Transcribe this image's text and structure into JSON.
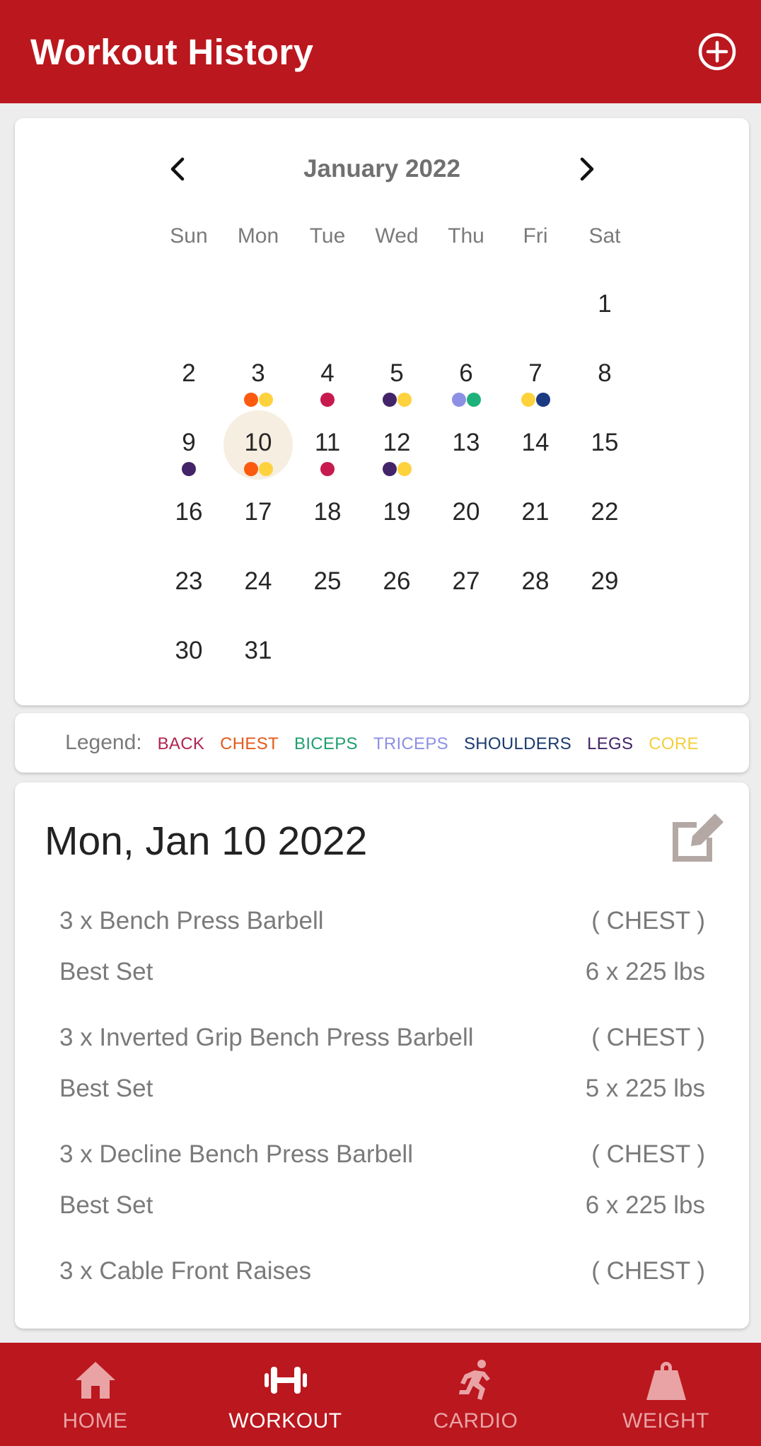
{
  "appbar": {
    "title": "Workout History",
    "add_icon": "add-circle-icon"
  },
  "calendar": {
    "month_label": "January 2022",
    "weekdays": [
      "Sun",
      "Mon",
      "Tue",
      "Wed",
      "Thu",
      "Fri",
      "Sat"
    ],
    "first_weekday_index": 6,
    "selected_day": 10,
    "selected_color": "#f6eee1",
    "days": [
      {
        "n": "1",
        "dots": []
      },
      {
        "n": "2",
        "dots": []
      },
      {
        "n": "3",
        "dots": [
          "#fb5a0f",
          "#fdd23d"
        ]
      },
      {
        "n": "4",
        "dots": [
          "#c71a4e"
        ]
      },
      {
        "n": "5",
        "dots": [
          "#432468",
          "#fdd23d"
        ]
      },
      {
        "n": "6",
        "dots": [
          "#8c90e4",
          "#1eb27a"
        ]
      },
      {
        "n": "7",
        "dots": [
          "#fdd23d",
          "#1a3a82"
        ]
      },
      {
        "n": "8",
        "dots": []
      },
      {
        "n": "9",
        "dots": [
          "#432468"
        ]
      },
      {
        "n": "10",
        "dots": [
          "#fb5a0f",
          "#fdd23d"
        ]
      },
      {
        "n": "11",
        "dots": [
          "#c71a4e"
        ]
      },
      {
        "n": "12",
        "dots": [
          "#432468",
          "#fdd23d"
        ]
      },
      {
        "n": "13",
        "dots": []
      },
      {
        "n": "14",
        "dots": []
      },
      {
        "n": "15",
        "dots": []
      },
      {
        "n": "16",
        "dots": []
      },
      {
        "n": "17",
        "dots": []
      },
      {
        "n": "18",
        "dots": []
      },
      {
        "n": "19",
        "dots": []
      },
      {
        "n": "20",
        "dots": []
      },
      {
        "n": "21",
        "dots": []
      },
      {
        "n": "22",
        "dots": []
      },
      {
        "n": "23",
        "dots": []
      },
      {
        "n": "24",
        "dots": []
      },
      {
        "n": "25",
        "dots": []
      },
      {
        "n": "26",
        "dots": []
      },
      {
        "n": "27",
        "dots": []
      },
      {
        "n": "28",
        "dots": []
      },
      {
        "n": "29",
        "dots": []
      },
      {
        "n": "30",
        "dots": []
      },
      {
        "n": "31",
        "dots": []
      }
    ]
  },
  "legend": {
    "label": "Legend:",
    "items": [
      {
        "name": "BACK",
        "color": "#b0244f"
      },
      {
        "name": "CHEST",
        "color": "#e35a1c"
      },
      {
        "name": "BICEPS",
        "color": "#1f9e6f"
      },
      {
        "name": "TRICEPS",
        "color": "#8c90e4"
      },
      {
        "name": "SHOULDERS",
        "color": "#1a3a6e"
      },
      {
        "name": "LEGS",
        "color": "#432468"
      },
      {
        "name": "CORE",
        "color": "#f3cf3d"
      }
    ]
  },
  "detail": {
    "date": "Mon, Jan 10 2022",
    "edit_icon": "edit-icon",
    "exercises": [
      {
        "name": "3 x Bench Press Barbell",
        "group": "( CHEST )",
        "best_label": "Best Set",
        "best_value": "6 x 225 lbs"
      },
      {
        "name": "3 x Inverted Grip Bench Press Barbell",
        "group": "( CHEST )",
        "best_label": "Best Set",
        "best_value": "5 x 225 lbs"
      },
      {
        "name": "3 x Decline Bench Press Barbell",
        "group": "( CHEST )",
        "best_label": "Best Set",
        "best_value": "6 x 225 lbs"
      },
      {
        "name": "3 x Cable Front Raises",
        "group": "( CHEST )",
        "best_label": "",
        "best_value": ""
      }
    ]
  },
  "nav": {
    "items": [
      {
        "label": "HOME",
        "icon": "home-icon",
        "active": false
      },
      {
        "label": "WORKOUT",
        "icon": "dumbbell-icon",
        "active": true
      },
      {
        "label": "CARDIO",
        "icon": "running-icon",
        "active": false
      },
      {
        "label": "WEIGHT",
        "icon": "weight-icon",
        "active": false
      }
    ]
  },
  "colors": {
    "brand": "#bb171e"
  }
}
